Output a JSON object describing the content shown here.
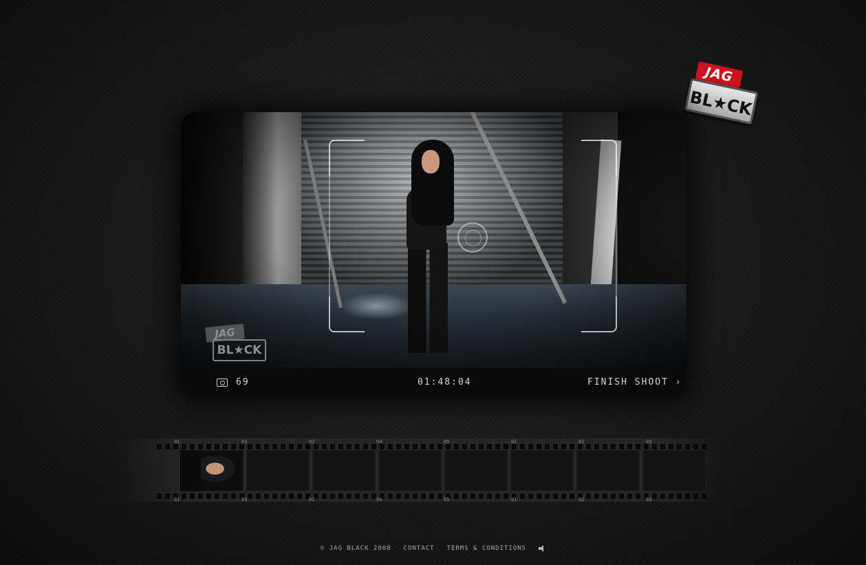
{
  "brand": {
    "line1": "JAG",
    "line2": "BL★CK"
  },
  "viewer": {
    "watermark_line1": "JAG",
    "watermark_line2": "BL★CK",
    "shots_count": "69",
    "timecode": "01:48:04",
    "finish_label": "FINISH SHOOT ›"
  },
  "filmstrip": {
    "top_labels": [
      "01",
      "03",
      "02",
      "04",
      "05",
      "01",
      "02",
      "03"
    ],
    "bottom_labels": [
      "01",
      "03",
      "02",
      "04",
      "05",
      "01",
      "02",
      "03"
    ],
    "frames": [
      {
        "filled": true
      },
      {
        "filled": false
      },
      {
        "filled": false
      },
      {
        "filled": false
      },
      {
        "filled": false
      },
      {
        "filled": false
      },
      {
        "filled": false
      },
      {
        "filled": false
      }
    ]
  },
  "footer": {
    "copyright": "© JAG BLACK 2008",
    "contact": "CONTACT",
    "terms": "TERMS & CONDITIONS"
  }
}
